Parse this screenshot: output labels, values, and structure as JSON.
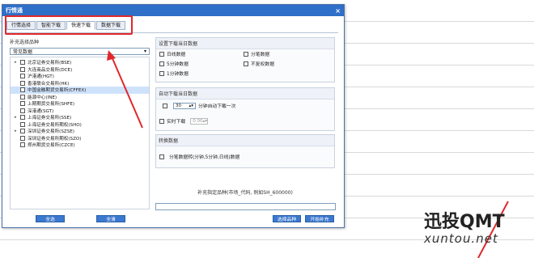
{
  "window": {
    "title": "行情通",
    "close_glyph": "×"
  },
  "tabs": [
    {
      "label": "行情选择"
    },
    {
      "label": "智能下载"
    },
    {
      "label": "快速下载"
    },
    {
      "label": "数据下载"
    }
  ],
  "left": {
    "section_label": "补充选择品种",
    "select_value": "常见数据",
    "select_arrow": "▾",
    "tree": [
      {
        "expander": "▸",
        "label": "北京证券交易所(BSE)"
      },
      {
        "expander": "",
        "label": "大连商品交易所(DCE)"
      },
      {
        "expander": "",
        "label": "沪港通(HGT)"
      },
      {
        "expander": "",
        "label": "香港联合交易所(HK)"
      },
      {
        "expander": "",
        "label": "中国金融期货交易所(CFFEX)"
      },
      {
        "expander": "",
        "label": "能源中心(INE)"
      },
      {
        "expander": "",
        "label": "上期期货交易所(SHFE)"
      },
      {
        "expander": "",
        "label": "深港通(SGT)"
      },
      {
        "expander": "▸",
        "label": "上海证券交易所(SSE)"
      },
      {
        "expander": "",
        "label": "上海证券交易所期权(SHO)"
      },
      {
        "expander": "▸",
        "label": "深圳证券交易所(SZSE)"
      },
      {
        "expander": "",
        "label": "深圳证券交易所期权(SZO)"
      },
      {
        "expander": "",
        "label": "郑州期货交易所(CZCE)"
      }
    ],
    "selected_index": 4
  },
  "group1": {
    "title": "设置下载当日数据",
    "items": [
      {
        "label": "日线数据"
      },
      {
        "label": "分笔数据"
      },
      {
        "label": "5分钟数据"
      },
      {
        "label": "不复权数据"
      },
      {
        "label": "1分钟数据"
      }
    ]
  },
  "group2": {
    "title": "自动下载当日数据",
    "interval_value": "30",
    "interval_label": "分钟自动下载一次",
    "realtime_label": "实时下载",
    "time_value": "0.00"
  },
  "group3": {
    "title": "转换数据",
    "convert_label": "分笔数据转(分钟,5分钟,日线)数据"
  },
  "hint": "补充指定品种(市场_代码, 例如SH_600000)",
  "buttons": {
    "select_all": "全选",
    "clear": "全清",
    "select_product": "选择品种",
    "start_supplement": "开始补充"
  },
  "logo": {
    "cn": "迅投QMT",
    "en": "xuntou.net"
  },
  "colors": {
    "titlebar": "#2e6fc8",
    "button": "#3b78cf",
    "highlight": "#e0282a"
  }
}
